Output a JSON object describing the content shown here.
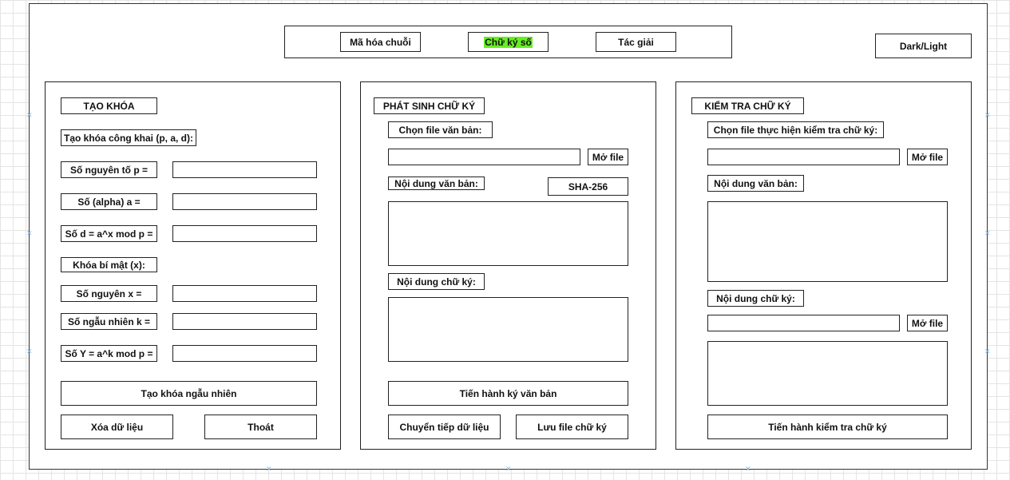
{
  "nav": {
    "tab_encrypt": "Mã hóa chuỗi",
    "tab_signature": "Chữ ký số",
    "tab_author": "Tác giải",
    "theme_toggle": "Dark/Light"
  },
  "keygen": {
    "title": "TẠO KHÓA",
    "public_key_label": "Tạo khóa công khai (p, a, d):",
    "prime_p_label": "Số nguyên tố p =",
    "alpha_label": "Số (alpha) a =",
    "d_label": "Số d = a^x mod p =",
    "private_key_label": "Khóa bí mật (x):",
    "x_label": "Số nguyên x =",
    "k_label": "Số ngẫu nhiên k =",
    "y_label": "Số Y = a^k mod p =",
    "random_button": "Tạo khóa ngẫu nhiên",
    "clear_button": "Xóa dữ liệu",
    "exit_button": "Thoát"
  },
  "sign": {
    "title": "PHÁT SINH CHỮ KÝ",
    "choose_file_label": "Chọn file văn bản:",
    "open_file_button": "Mở file",
    "content_label": "Nội dung văn bản:",
    "hash_button": "SHA-256",
    "signature_label": "Nội dung chữ ký:",
    "sign_button": "Tiến hành ký văn bản",
    "forward_button": "Chuyển tiếp dữ liệu",
    "save_button": "Lưu file chữ ký"
  },
  "verify": {
    "title": "KIỂM TRA CHỮ KÝ",
    "choose_file_label": "Chọn file thực hiện kiểm tra chữ ký:",
    "open_file_button": "Mở file",
    "content_label": "Nội dung văn bản:",
    "signature_label": "Nội dung chữ ký:",
    "open_sig_button": "Mở file",
    "verify_button": "Tiến hành kiểm tra chữ ký"
  },
  "colors": {
    "active_tab_highlight": "#66ee22",
    "border": "#222222"
  }
}
